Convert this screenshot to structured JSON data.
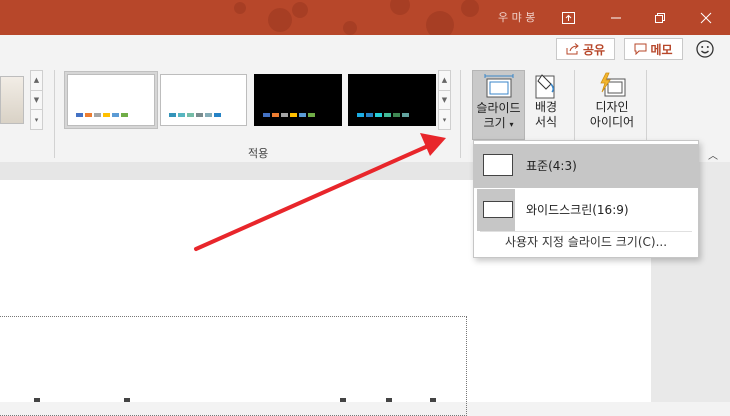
{
  "window": {
    "user_name": "우 먀 봉",
    "controls": [
      "ribbon-display-icon",
      "minimize-icon",
      "restore-icon",
      "close-icon"
    ]
  },
  "command_bar": {
    "share_label": "공유",
    "comment_label": "메모"
  },
  "ribbon": {
    "themes_group_label": "적용",
    "themes": [
      {
        "bg": "#ffffff",
        "bar_colors": [
          "#4472c4",
          "#ed7d31",
          "#a5a5a5",
          "#ffc000",
          "#5b9bd5",
          "#70ad47"
        ]
      },
      {
        "bg": "#ffffff",
        "bar_colors": [
          "#3494ba",
          "#58b6c0",
          "#75bda7",
          "#7a8c8e",
          "#84acb6",
          "#2683c6"
        ]
      },
      {
        "bg": "#000000",
        "bar_colors": [
          "#4472c4",
          "#ed7d31",
          "#a5a5a5",
          "#ffc000",
          "#5b9bd5",
          "#70ad47"
        ]
      },
      {
        "bg": "#000000",
        "bar_colors": [
          "#1cade4",
          "#2683c6",
          "#27ced7",
          "#42ba97",
          "#3e8853",
          "#62a39f"
        ]
      }
    ],
    "slide_size_label_1": "슬라이드",
    "slide_size_label_2": "크기",
    "format_bg_label_1": "배경",
    "format_bg_label_2": "서식",
    "designer_label_1": "디자인",
    "designer_label_2": "아이디어"
  },
  "dropdown": {
    "items": [
      {
        "label": "표준(4:3)",
        "selected": true
      },
      {
        "label": "와이드스크린(16:9)",
        "selected": false
      }
    ],
    "custom_label": "사용자 지정 슬라이드 크기(C)..."
  },
  "colors": {
    "accent": "#b7472a",
    "arrow": "#e8262b"
  }
}
